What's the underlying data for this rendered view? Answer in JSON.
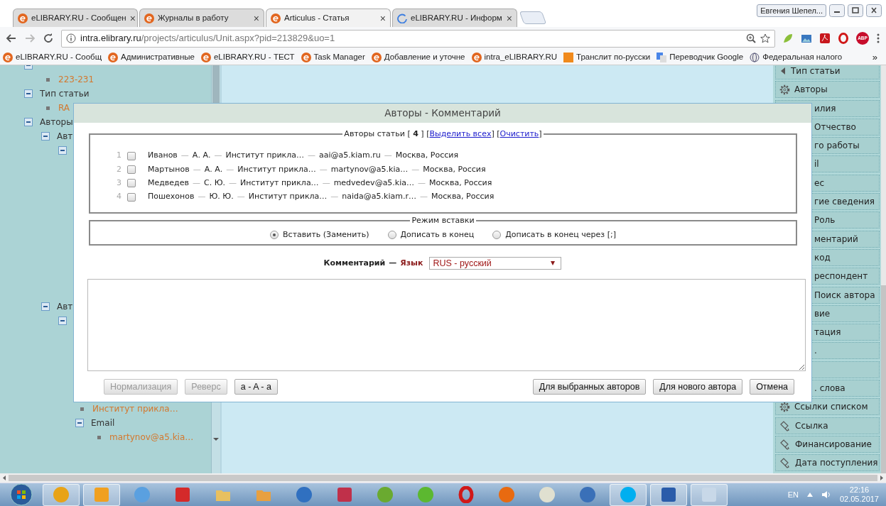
{
  "browser": {
    "profile": "Евгения Шепел...",
    "tabs": [
      {
        "title": "eLIBRARY.RU - Сообщен",
        "close": "×",
        "selected": false,
        "kind": "logo"
      },
      {
        "title": "Журналы в работу",
        "close": "×",
        "selected": false,
        "kind": "logo"
      },
      {
        "title": "Articulus - Статья",
        "close": "×",
        "selected": true,
        "kind": "logo"
      },
      {
        "title": "eLIBRARY.RU - Информ",
        "close": "×",
        "selected": false,
        "kind": "loading"
      }
    ],
    "address": {
      "host": "intra.elibrary.ru",
      "path": "/projects/articulus/Unit.aspx?pid=213829&uo=1"
    },
    "extensions": [
      {
        "kind": "leaf"
      },
      {
        "kind": "picture"
      },
      {
        "kind": "pdf"
      },
      {
        "kind": "ring"
      },
      {
        "kind": "badge",
        "label": "ABP"
      }
    ],
    "bookmarks": [
      {
        "label": "eLIBRARY.RU - Сообщ",
        "kind": "logo"
      },
      {
        "label": "Административные",
        "kind": "logo"
      },
      {
        "label": "eLIBRARY.RU - ТЕСТ",
        "kind": "logo"
      },
      {
        "label": "Task Manager",
        "kind": "logo"
      },
      {
        "label": "Добавление и уточне",
        "kind": "logo"
      },
      {
        "label": "intra_eLIBRARY.RU",
        "kind": "logo"
      },
      {
        "label": "Транслит по-русски",
        "kind": "square"
      },
      {
        "label": "Переводчик Google",
        "kind": "translate"
      },
      {
        "label": "Федеральная налого",
        "kind": "globe"
      }
    ],
    "bookmarks_more": "»"
  },
  "tree": [
    {
      "expanded": true,
      "children": [
        {
          "label": "223-231"
        }
      ]
    },
    {
      "label": "Тип статьи",
      "expanded": true,
      "children": [
        {
          "label": "RA"
        }
      ]
    },
    {
      "label": "Авторы",
      "expanded": true,
      "children": [
        {
          "label": "Авт",
          "expanded": true,
          "children": [
            {
              "expanded": true
            }
          ]
        },
        {
          "label": "Авт",
          "expanded": true,
          "children": [
            {
              "expanded": true,
              "children": [
                {
                  "label": "Институт прикла…"
                },
                {
                  "label": "Email",
                  "expanded": true,
                  "children": [
                    {
                      "label": "martynov@a5.kia…"
                    }
                  ]
                }
              ]
            }
          ]
        }
      ]
    }
  ],
  "side_menu": [
    {
      "kind": "back",
      "label": "Тип статьи"
    },
    {
      "kind": "gear",
      "label": "Авторы"
    },
    {
      "kind": "covered",
      "label": "илия"
    },
    {
      "kind": "covered",
      "label": "Отчество"
    },
    {
      "kind": "covered",
      "label": "го работы"
    },
    {
      "kind": "covered",
      "label": "il"
    },
    {
      "kind": "covered",
      "label": "ес"
    },
    {
      "kind": "covered",
      "label": "гие сведения"
    },
    {
      "kind": "covered",
      "label": "Роль"
    },
    {
      "kind": "covered",
      "label": "ментарий"
    },
    {
      "kind": "covered",
      "label": "код"
    },
    {
      "kind": "covered",
      "label": "респондент"
    },
    {
      "kind": "covered",
      "label": "Поиск автора"
    },
    {
      "kind": "covered",
      "label": "вие"
    },
    {
      "kind": "covered",
      "label": "тация"
    },
    {
      "kind": "covered",
      "label": "."
    },
    {
      "kind": "covered"
    },
    {
      "kind": "covered",
      "label": ". слова"
    },
    {
      "kind": "gear",
      "label": "Ссылки списком"
    },
    {
      "kind": "tag",
      "label": "Ссылка"
    },
    {
      "kind": "tag",
      "label": "Финансирование"
    },
    {
      "kind": "tag",
      "label": "Дата поступления"
    }
  ],
  "dialog": {
    "title": "Авторы - Комментарий",
    "authors": {
      "legend": "Авторы статьи [ **4** ]",
      "links": [
        {
          "open": "[",
          "label": "Выделить всех",
          "close": "]"
        },
        {
          "open": "[",
          "label": "Очистить",
          "close": "]"
        }
      ],
      "separator": "—",
      "rows": [
        {
          "number": "1",
          "checked": false,
          "parts": [
            "Иванов",
            "А. А.",
            "Институт прикла…",
            "aai@a5.kiam.ru",
            "Москва, Россия"
          ]
        },
        {
          "number": "2",
          "checked": false,
          "parts": [
            "Мартынов",
            "А. А.",
            "Институт прикла…",
            "martynov@a5.kia…",
            "Москва, Россия"
          ]
        },
        {
          "number": "3",
          "checked": false,
          "parts": [
            "Медведев",
            "С. Ю.",
            "Институт прикла…",
            "medvedev@a5.kia…",
            "Москва, Россия"
          ]
        },
        {
          "number": "4",
          "checked": false,
          "parts": [
            "Пошехонов",
            "Ю. Ю.",
            "Институт прикла…",
            "naida@a5.kiam.r…",
            "Москва, Россия"
          ]
        }
      ]
    },
    "insert_mode": {
      "legend": "Режим вставки",
      "options": [
        {
          "label": "Вставить (Заменить)",
          "selected": true
        },
        {
          "label": "Дописать в конец",
          "selected": false
        },
        {
          "label": "Дописать в конец через [;]",
          "selected": false
        }
      ]
    },
    "comment": {
      "label": "Комментарий",
      "dash": "—",
      "language_label": "Язык",
      "language": "RUS - русский"
    },
    "left_buttons": [
      {
        "label": "Нормализация",
        "disabled": true
      },
      {
        "label": "Реверс",
        "disabled": true
      },
      {
        "label": "a - A - a",
        "disabled": false
      }
    ],
    "right_buttons": [
      {
        "label": "Для выбранных авторов",
        "disabled": false
      },
      {
        "label": "Для нового автора",
        "disabled": false
      },
      {
        "label": "Отмена",
        "disabled": false
      }
    ]
  },
  "taskbar": {
    "apps": [
      {
        "kind": "circle",
        "color": "#e8a317",
        "active": true
      },
      {
        "kind": "square",
        "color": "#f0a020",
        "active": true
      },
      {
        "kind": "circle",
        "color": "#5aa0e0",
        "active": false
      },
      {
        "kind": "square",
        "color": "#d42a2a",
        "active": false
      },
      {
        "kind": "folder",
        "color": "#e8c060",
        "active": false
      },
      {
        "kind": "folder",
        "color": "#e8a040",
        "active": false
      },
      {
        "kind": "circle",
        "color": "#3070c0",
        "active": false
      },
      {
        "kind": "square",
        "color": "#c0304a",
        "active": false
      },
      {
        "kind": "circle",
        "color": "#6aaa30",
        "active": false
      },
      {
        "kind": "circle",
        "color": "#5cb830",
        "active": false
      },
      {
        "kind": "ring",
        "color": "#d01818",
        "active": false
      },
      {
        "kind": "circle",
        "color": "#e86a10",
        "active": false
      },
      {
        "kind": "circle",
        "color": "#e0e0d0",
        "active": false
      },
      {
        "kind": "circle",
        "color": "#3a70b8",
        "active": false
      },
      {
        "kind": "circle",
        "color": "#00aff0",
        "active": true
      },
      {
        "kind": "square",
        "color": "#2a5caa",
        "active": true
      },
      {
        "kind": "square",
        "color": "#c8d8e8",
        "active": true
      }
    ],
    "language": "EN",
    "time": "22:16",
    "date": "02.05.2017"
  }
}
